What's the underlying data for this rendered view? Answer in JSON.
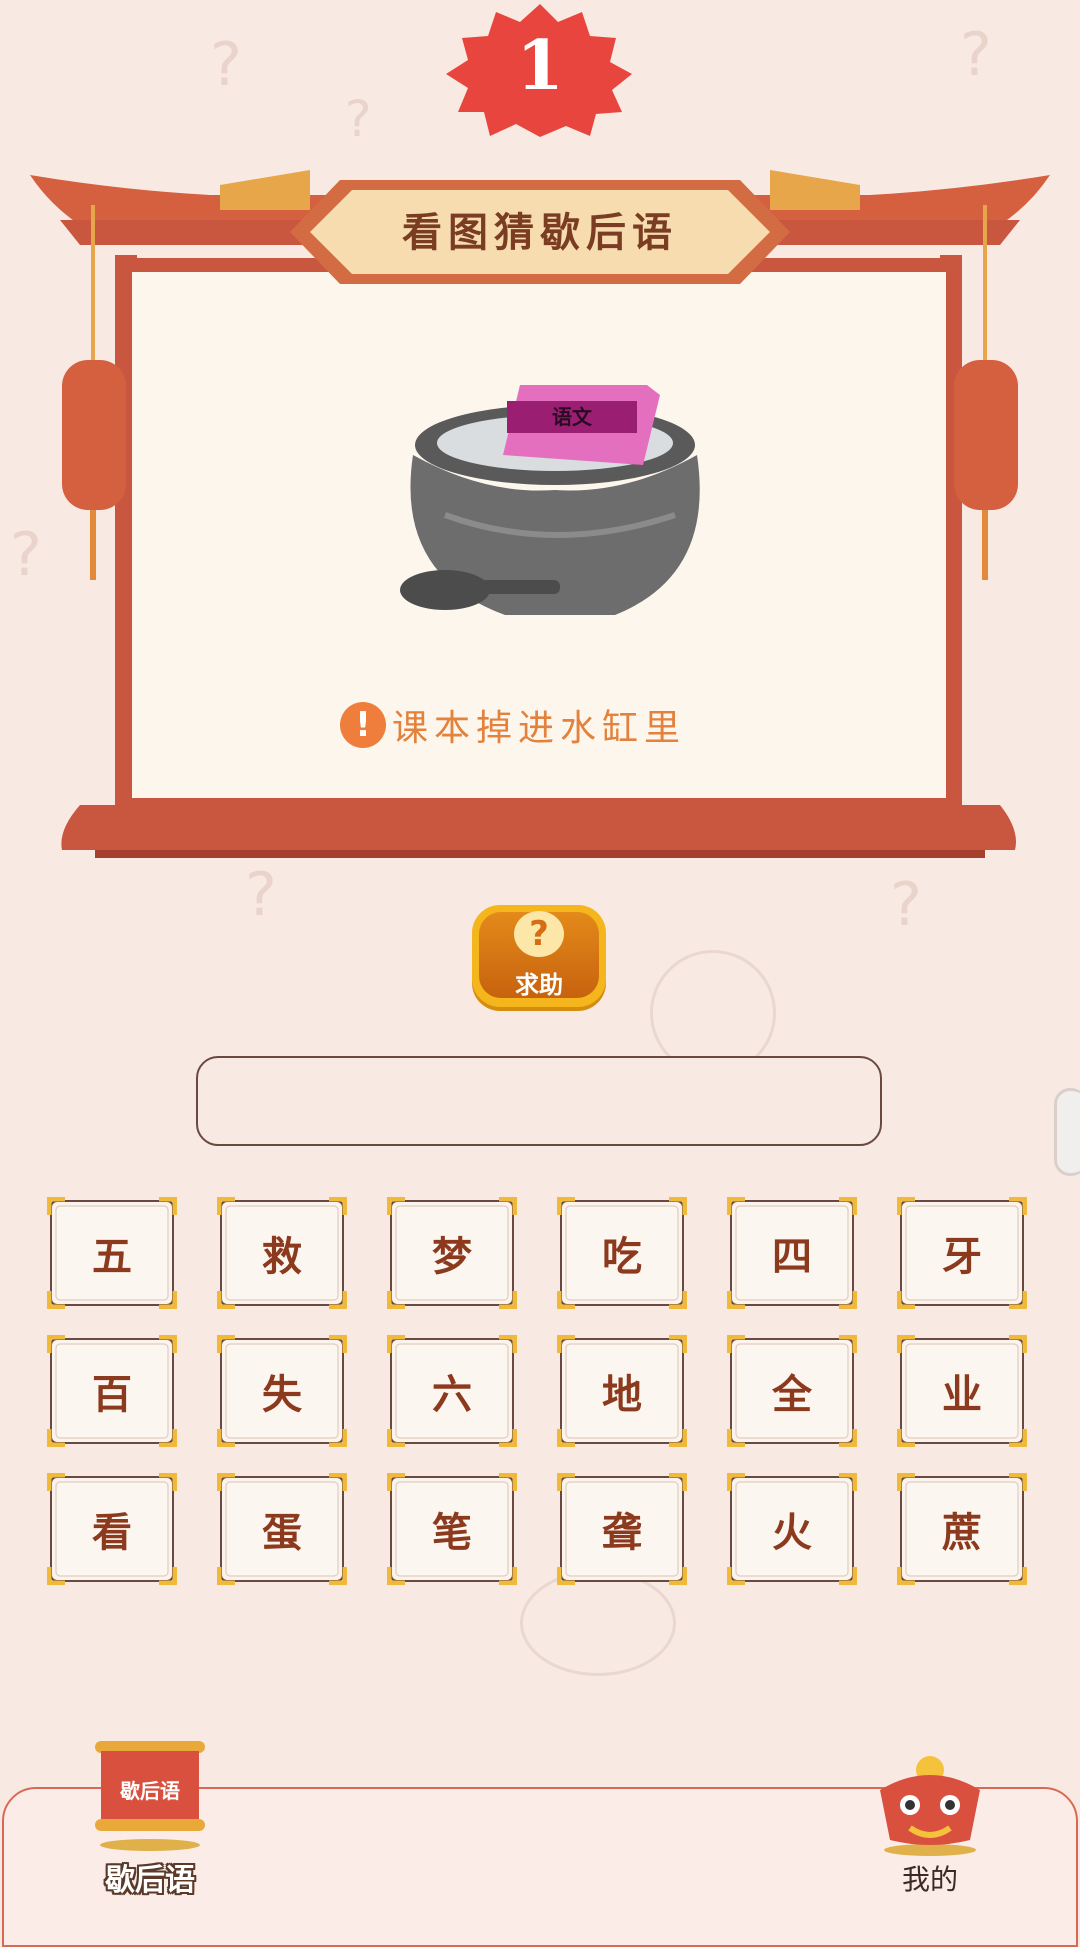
{
  "level": {
    "number": "1"
  },
  "frame": {
    "title": "看图猜歇后语"
  },
  "picture": {
    "book_label": "语文"
  },
  "hint": {
    "icon": "exclamation-icon",
    "text": "课本掉进水缸里"
  },
  "help_button": {
    "label": "求助",
    "icon": "question-icon"
  },
  "answer": {
    "value": ""
  },
  "characters": [
    "五",
    "救",
    "梦",
    "吃",
    "四",
    "牙",
    "百",
    "失",
    "六",
    "地",
    "全",
    "业",
    "看",
    "蛋",
    "笔",
    "聋",
    "火",
    "蔗"
  ],
  "bottom_nav": {
    "tabs": [
      {
        "label": "歇后语",
        "icon": "scroll-icon",
        "scroll_text": "歇后语",
        "active": true
      },
      {
        "label": "我的",
        "icon": "lion-dance-icon",
        "active": false
      }
    ]
  },
  "colors": {
    "background": "#f8e9e3",
    "frame_red": "#c9573f",
    "accent_orange": "#e2823d",
    "tile_border": "#f0b93a",
    "char_text": "#8c3a1e"
  }
}
